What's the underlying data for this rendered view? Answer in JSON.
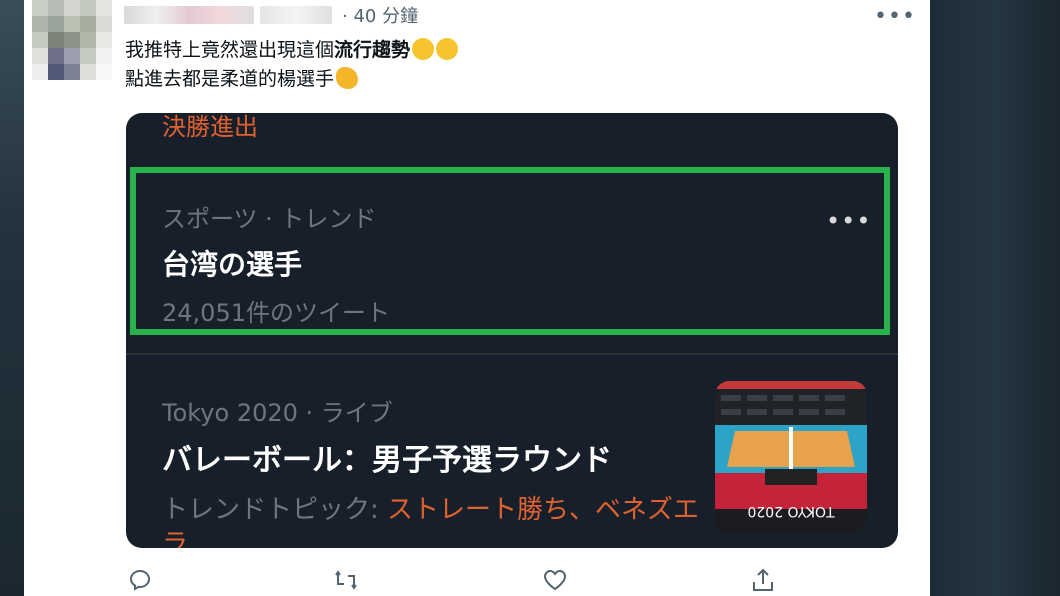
{
  "tweet": {
    "timestamp": "· 40 分鐘",
    "text_line1_normal": "我推特上竟然還出現這個",
    "text_line1_bold": "流行趨勢",
    "text_line2": "點進去都是柔道的楊選手"
  },
  "card": {
    "top_link": "決勝進出",
    "trend1": {
      "category": "スポーツ · トレンド",
      "title": "台湾の選手",
      "count": "24,051件のツイート"
    },
    "trend2": {
      "category": "Tokyo 2020 · ライブ",
      "title": "バレーボール：男子予選ラウンド",
      "topic_prefix": "トレンドトピック: ",
      "topic_link": "ストレート勝ち、ベネズエラ",
      "image_text": "TOKYO 2020"
    }
  },
  "icons": {
    "reply": "reply-icon",
    "retweet": "retweet-icon",
    "like": "like-icon",
    "share": "share-icon",
    "more": "more-icon"
  },
  "colors": {
    "highlight": "#27b24a",
    "trend_link": "#e0612f",
    "card_bg": "#17202a"
  }
}
